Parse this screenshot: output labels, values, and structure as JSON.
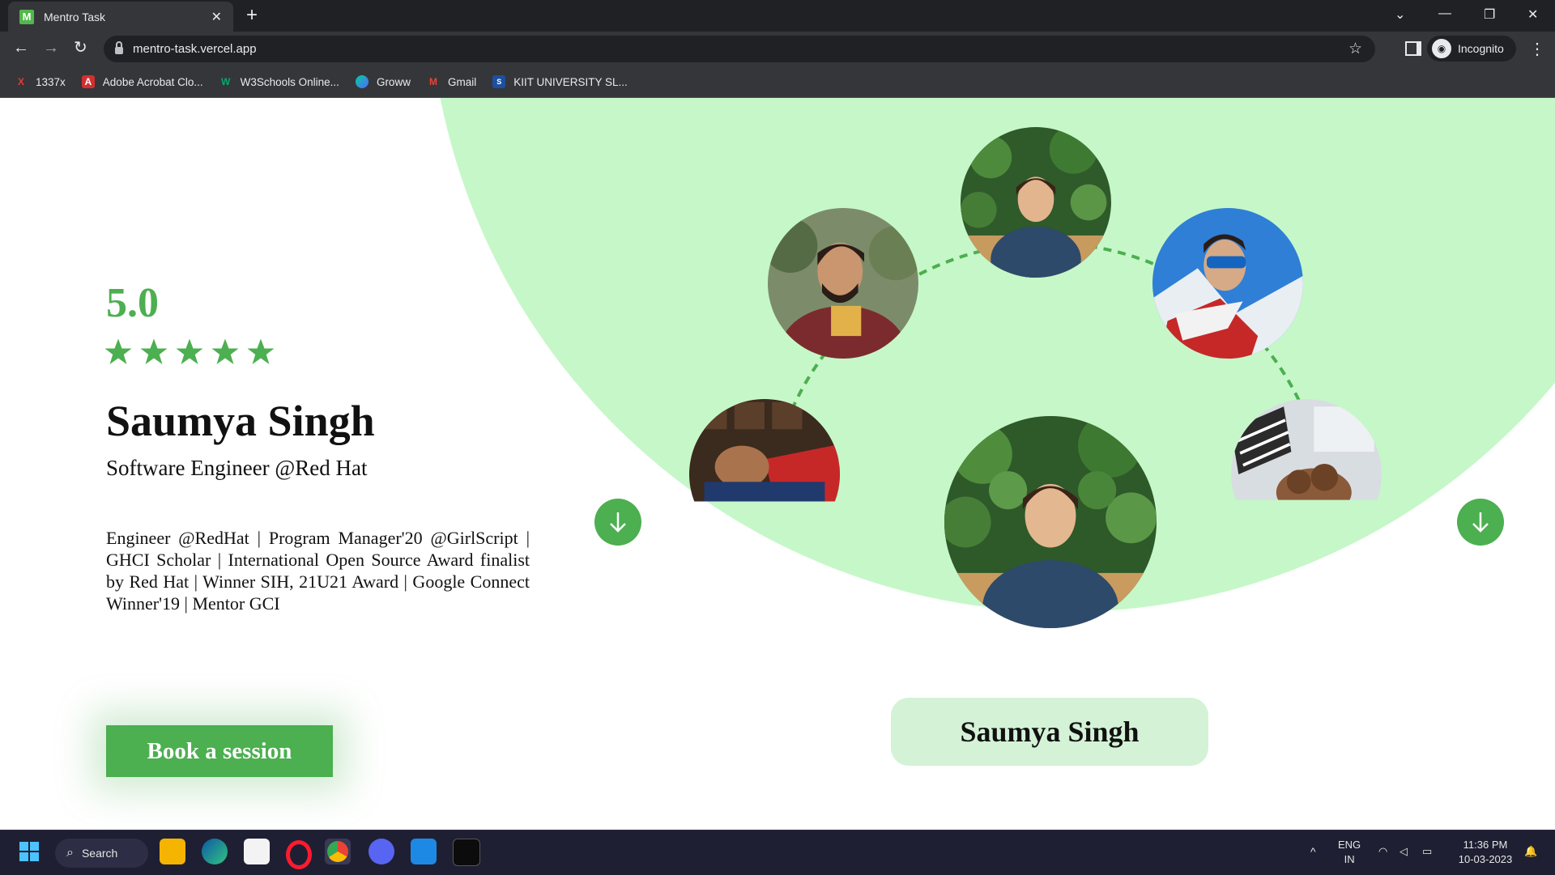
{
  "browser": {
    "tab_title": "Mentro Task",
    "tab_favicon": "M",
    "url": "mentro-task.vercel.app",
    "profile_label": "Incognito",
    "bookmarks": [
      {
        "label": "1337x",
        "icon": "x-icon",
        "color": "#e53935",
        "glyph": "X"
      },
      {
        "label": "Adobe Acrobat Clo...",
        "icon": "acrobat-icon",
        "color": "#d32f2f",
        "glyph": "A"
      },
      {
        "label": "W3Schools Online...",
        "icon": "w3schools-icon",
        "color": "#04aa6d",
        "glyph": "W"
      },
      {
        "label": "Groww",
        "icon": "groww-icon",
        "color": "#5367ff",
        "glyph": ""
      },
      {
        "label": "Gmail",
        "icon": "gmail-icon",
        "color": "#ea4335",
        "glyph": "M"
      },
      {
        "label": "KIIT UNIVERSITY SL...",
        "icon": "sap-icon",
        "color": "#1e4fa1",
        "glyph": "S"
      }
    ]
  },
  "mentor": {
    "rating": "5.0",
    "stars_filled": 5,
    "name": "Saumya Singh",
    "role": "Software Engineer @Red Hat",
    "bio": "Engineer @RedHat | Program Manager'20 @GirlScript | GHCI Scholar | International Open Source Award finalist by Red Hat | Winner SIH, 21U21 Award | Google Connect Winner'19 | Mentor GCI",
    "book_label": "Book a session",
    "selected_name": "Saumya Singh"
  },
  "colors": {
    "accent": "#4caf50",
    "bg_circle": "#c6f7c8",
    "pill": "#d4f2d6"
  },
  "taskbar": {
    "search_label": "Search",
    "lang_line1": "ENG",
    "lang_line2": "IN",
    "time": "11:36 PM",
    "date": "10-03-2023"
  }
}
